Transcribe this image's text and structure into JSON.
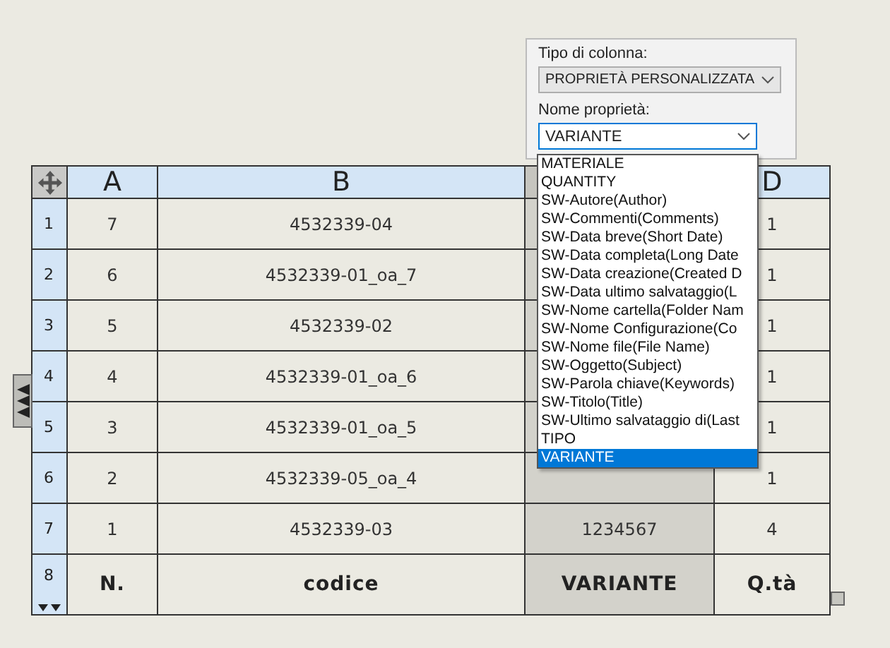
{
  "table": {
    "columns": [
      {
        "label": "A",
        "selected": false
      },
      {
        "label": "B",
        "selected": false
      },
      {
        "selected": true
      },
      {
        "label": "D",
        "selected": false
      }
    ],
    "rows": [
      {
        "number": "1",
        "kind": "data",
        "cells": [
          "7",
          "4532339-04",
          null,
          "1"
        ]
      },
      {
        "number": "2",
        "kind": "data",
        "cells": [
          "6",
          "4532339-01_oa_7",
          null,
          "1"
        ]
      },
      {
        "number": "3",
        "kind": "data",
        "cells": [
          "5",
          "4532339-02",
          null,
          "1"
        ]
      },
      {
        "number": "4",
        "kind": "data",
        "cells": [
          "4",
          "4532339-01_oa_6",
          null,
          "1"
        ]
      },
      {
        "number": "5",
        "kind": "data",
        "cells": [
          "3",
          "4532339-01_oa_5",
          null,
          "1"
        ]
      },
      {
        "number": "6",
        "kind": "data",
        "cells": [
          "2",
          "4532339-05_oa_4",
          null,
          "1"
        ]
      },
      {
        "number": "7",
        "kind": "data",
        "cells": [
          "1",
          "4532339-03",
          "1234567",
          "4"
        ]
      },
      {
        "number": "8",
        "kind": "header",
        "cells": [
          "N.",
          "codice",
          "VARIANTE",
          "Q.tà"
        ]
      }
    ]
  },
  "column_panel": {
    "column_type_label": "Tipo di colonna:",
    "column_type": "PROPRIETÀ PERSONALIZZATA",
    "property_label": "Nome proprietà:",
    "property": "VARIANTE",
    "options": [
      {
        "label": "MATERIALE",
        "selected": false
      },
      {
        "label": "QUANTITY",
        "selected": false
      },
      {
        "label": "SW-Autore(Author)",
        "selected": false
      },
      {
        "label": "SW-Commenti(Comments)",
        "selected": false
      },
      {
        "label": "SW-Data breve(Short Date)",
        "selected": false
      },
      {
        "label": "SW-Data completa(Long Date",
        "selected": false
      },
      {
        "label": "SW-Data creazione(Created D",
        "selected": false
      },
      {
        "label": "SW-Data ultimo salvataggio(L",
        "selected": false
      },
      {
        "label": "SW-Nome cartella(Folder Nam",
        "selected": false
      },
      {
        "label": "SW-Nome Configurazione(Co",
        "selected": false
      },
      {
        "label": "SW-Nome file(File Name)",
        "selected": false
      },
      {
        "label": "SW-Oggetto(Subject)",
        "selected": false
      },
      {
        "label": "SW-Parola chiave(Keywords)",
        "selected": false
      },
      {
        "label": "SW-Titolo(Title)",
        "selected": false
      },
      {
        "label": "SW-Ultimo salvataggio di(Last",
        "selected": false
      },
      {
        "label": "TIPO",
        "selected": false
      },
      {
        "label": "VARIANTE",
        "selected": true
      }
    ]
  }
}
